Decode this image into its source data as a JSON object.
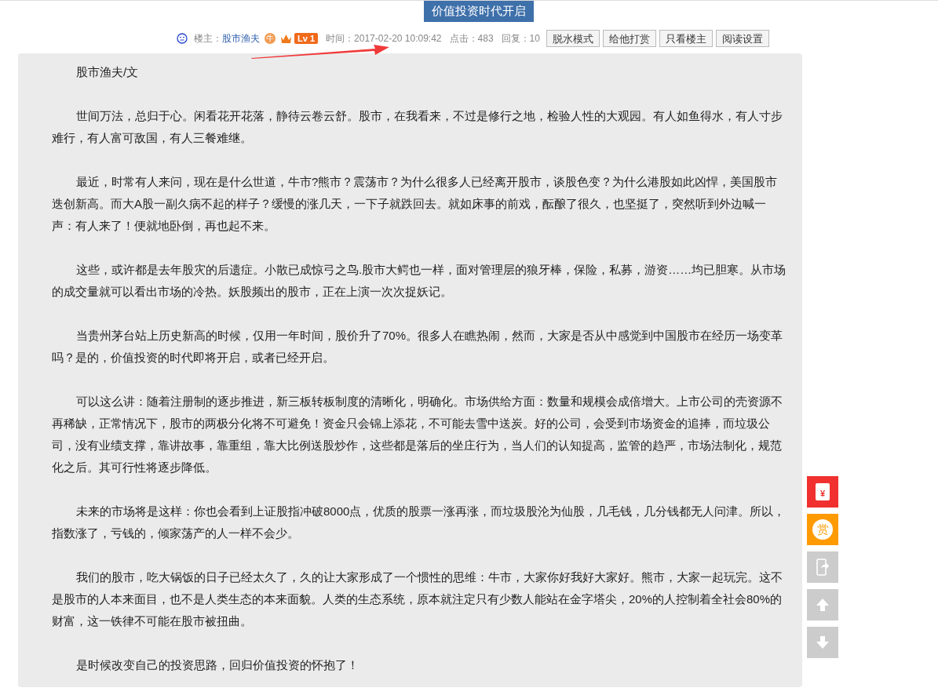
{
  "post_title": "价值投资时代开启",
  "meta": {
    "author_label": "楼主：",
    "author": "股市渔夫",
    "author_badge": "牛",
    "level": "Lv 1",
    "time": "时间：2017-02-20 10:09:42",
    "clicks": "点击：483",
    "replies": "回复：10"
  },
  "actions": [
    "脱水模式",
    "给他打赏",
    "只看楼主",
    "阅读设置"
  ],
  "paragraphs": [
    "股市渔夫/文",
    "世间万法，总归于心。闲看花开花落，静待云卷云舒。股市，在我看来，不过是修行之地，检验人性的大观园。有人如鱼得水，有人寸步难行，有人富可敌国，有人三餐难继。",
    "最近，时常有人来问，现在是什么世道，牛市?熊市？震荡市？为什么很多人已经离开股市，谈股色变？为什么港股如此凶悍，美国股市迭创新高。而大A股一副久病不起的样子？缓慢的涨几天，一下子就跌回去。就如床事的前戏，酝酿了很久，也坚挺了，突然听到外边喊一声：有人来了！便就地卧倒，再也起不来。",
    "这些，或许都是去年股灾的后遗症。小散已成惊弓之鸟.股市大鳄也一样，面对管理层的狼牙棒，保险，私募，游资……均已胆寒。从市场的成交量就可以看出市场的冷热。妖股频出的股市，正在上演一次次捉妖记。",
    "当贵州茅台站上历史新高的时候，仅用一年时间，股价升了70%。很多人在瞧热闹，然而，大家是否从中感觉到中国股市在经历一场变革吗？是的，价值投资的时代即将开启，或者已经开启。",
    "可以这么讲：随着注册制的逐步推进，新三板转板制度的清晰化，明确化。市场供给方面：数量和规模会成倍增大。上市公司的壳资源不再稀缺，正常情况下，股市的两极分化将不可避免！资金只会锦上添花，不可能去雪中送炭。好的公司，会受到市场资金的追捧，而垃圾公司，没有业绩支撑，靠讲故事，靠重组，靠大比例送股炒作，这些都是落后的坐庄行为，当人们的认知提高，监管的趋严，市场法制化，规范化之后。其可行性将逐步降低。",
    "未来的市场将是这样：你也会看到上证股指冲破8000点，优质的股票一涨再涨，而垃圾股沦为仙股，几毛钱，几分钱都无人问津。所以，指数涨了，亏钱的，倾家荡产的人一样不会少。",
    "我们的股市，吃大锅饭的日子已经太久了，久的让大家形成了一个惯性的思维：牛市，大家你好我好大家好。熊市，大家一起玩完。这不是股市的人本来面目，也不是人类生态的本来面貌。人类的生态系统，原本就注定只有少数人能站在金字塔尖，20%的人控制着全社会80%的财富，这一铁律不可能在股市被扭曲。",
    "是时候改变自己的投资思路，回归价值投资的怀抱了！"
  ],
  "side_tools": [
    {
      "kind": "redpacket",
      "glyph": "¥"
    },
    {
      "kind": "reward",
      "glyph": "赏"
    },
    {
      "kind": "mobile"
    },
    {
      "kind": "up"
    },
    {
      "kind": "down"
    }
  ]
}
